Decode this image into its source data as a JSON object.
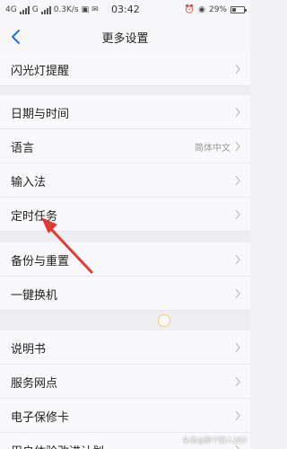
{
  "status_bar": {
    "network": "4G",
    "carrier": "G",
    "speed": "0.3K/s",
    "time": "03:42",
    "battery": "29%"
  },
  "nav": {
    "title": "更多设置"
  },
  "rows": [
    {
      "label": "闪光灯提醒",
      "value": ""
    },
    {
      "label": "日期与时间",
      "value": ""
    },
    {
      "label": "语言",
      "value": "简体中文"
    },
    {
      "label": "输入法",
      "value": ""
    },
    {
      "label": "定时任务",
      "value": ""
    },
    {
      "label": "备份与重置",
      "value": ""
    },
    {
      "label": "一键换机",
      "value": ""
    },
    {
      "label": "说明书",
      "value": ""
    },
    {
      "label": "服务网点",
      "value": ""
    },
    {
      "label": "电子保修卡",
      "value": ""
    },
    {
      "label": "用户体验改进计划",
      "value": ""
    }
  ],
  "watermark": "头条@那个懒人283",
  "colors": {
    "arrow": "#e53935",
    "back": "#1a73e8"
  }
}
